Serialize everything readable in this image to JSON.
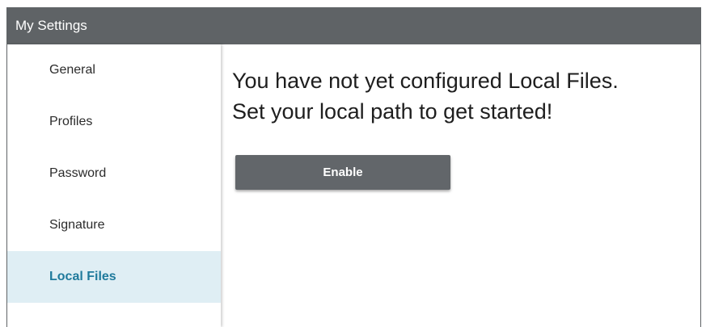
{
  "window": {
    "title": "My Settings"
  },
  "sidebar": {
    "items": [
      {
        "label": "General",
        "active": false
      },
      {
        "label": "Profiles",
        "active": false
      },
      {
        "label": "Password",
        "active": false
      },
      {
        "label": "Signature",
        "active": false
      },
      {
        "label": "Local Files",
        "active": true
      }
    ]
  },
  "main": {
    "heading_line1": "You have not yet configured Local Files.",
    "heading_line2": "Set your local path to get started!",
    "enable_button_label": "Enable"
  },
  "colors": {
    "titlebar": "#5f6366",
    "active_item_background": "#dfeef4",
    "active_item_text": "#1f7a9c",
    "button": "#62666a"
  }
}
